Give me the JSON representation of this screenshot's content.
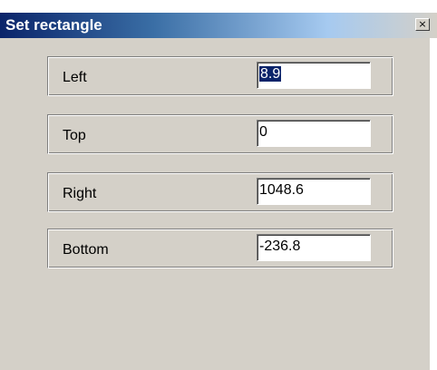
{
  "window": {
    "title": "Set rectangle",
    "close_label": "×"
  },
  "fields": [
    {
      "label": "Left",
      "value": "8.9",
      "selected": true
    },
    {
      "label": "Top",
      "value": "0"
    },
    {
      "label": "Right",
      "value": "1048.6"
    },
    {
      "label": "Bottom",
      "value": "-236.8"
    }
  ],
  "colors": {
    "title_start": "#0a246a",
    "title_end": "#a6caf0",
    "face": "#d4d0c8",
    "selection": "#0a246a"
  }
}
